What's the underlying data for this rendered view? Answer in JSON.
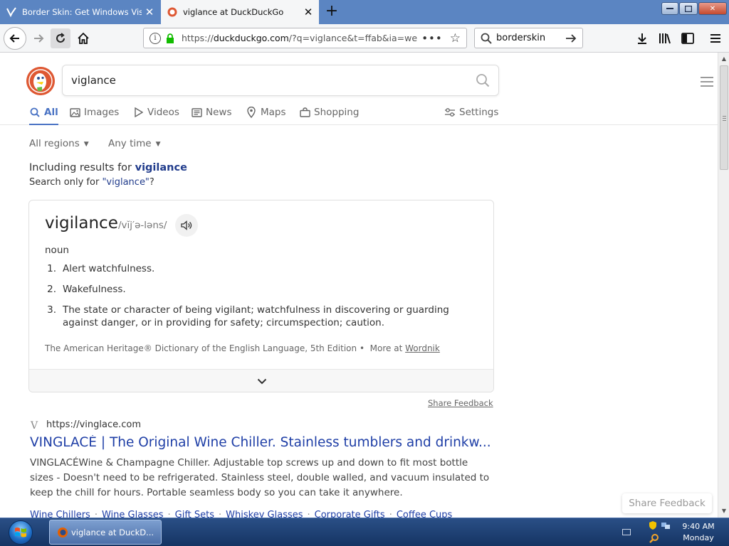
{
  "browser": {
    "tabs": [
      {
        "title": "Border Skin: Get Windows Vista",
        "active": false
      },
      {
        "title": "viglance at DuckDuckGo",
        "active": true
      }
    ],
    "url_prefix": "https://",
    "url_host": "duckduckgo.com",
    "url_rest": "/?q=viglance&t=ffab&ia=web",
    "search_value": "borderskin"
  },
  "ddg": {
    "query": "viglance",
    "tabs": [
      {
        "label": "All",
        "icon": "search-icon",
        "active": true
      },
      {
        "label": "Images",
        "icon": "image-icon"
      },
      {
        "label": "Videos",
        "icon": "play-icon"
      },
      {
        "label": "News",
        "icon": "news-icon"
      },
      {
        "label": "Maps",
        "icon": "map-pin-icon"
      },
      {
        "label": "Shopping",
        "icon": "bag-icon"
      }
    ],
    "settings_label": "Settings",
    "filters": {
      "region": "All regions",
      "time": "Any time"
    },
    "spelling": {
      "including_prefix": "Including results for ",
      "corrected": "vigilance",
      "only_prefix": "Search only for ",
      "only_term": "\"viglance\"",
      "only_suffix": "?"
    }
  },
  "definition": {
    "word": "vigilance",
    "pronunciation": "/vĭj′ə-ləns/",
    "part_of_speech": "noun",
    "senses": [
      {
        "n": "1.",
        "text": "Alert watchfulness."
      },
      {
        "n": "2.",
        "text": "Wakefulness."
      },
      {
        "n": "3.",
        "text": "The state or character of being vigilant; watchfulness in discovering or guarding against danger, or in providing for safety; circumspection; caution."
      }
    ],
    "source": "The American Heritage® Dictionary of the English Language, 5th Edition •",
    "more_at_prefix": "More at ",
    "more_at_link": "Wordnik",
    "share_feedback": "Share Feedback"
  },
  "result": {
    "favicon_letter": "V",
    "url": "https://vinglace.com",
    "title": "VINGLACÉ | The Original Wine Chiller. Stainless tumblers and drinkw...",
    "snippet": "VINGLACÉWine & Champagne Chiller. Adjustable top screws up and down to fit most bottle sizes - Doesn't need to be refrigerated. Stainless steel, double walled, and vacuum insulated to keep the chill for hours. Portable seamless body so you can take it anywhere.",
    "sitelinks": [
      "Wine Chillers",
      "Wine Glasses",
      "Gift Sets",
      "Whiskey Glasses",
      "Corporate Gifts",
      "Coffee Cups"
    ]
  },
  "floating_feedback": "Share Feedback",
  "taskbar": {
    "window_label": "viglance at DuckD...",
    "time": "9:40 AM",
    "day": "Monday"
  },
  "colors": {
    "ddg_orange": "#de5833",
    "link_blue": "#1e3ea6",
    "active_tab_blue": "#4a73c4",
    "tabbar_blue": "#5b85c2"
  }
}
